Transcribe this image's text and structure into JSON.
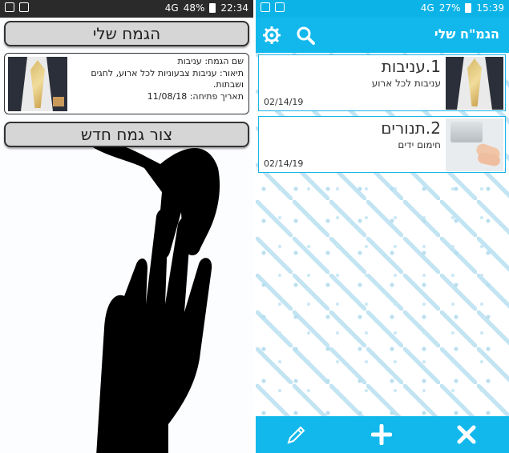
{
  "left_screen": {
    "status_bar": {
      "signal": "4G",
      "battery": "48%",
      "time": "22:34"
    },
    "my_gemach_button": "הגמח שלי",
    "card": {
      "name_line": "שם הגמח: עניבות",
      "desc_line": "תיאור: עניבות צבעוניות לכל ארוע, לחגים ושבתות.",
      "date_line": "תאריך פתיחה: 11/08/18"
    },
    "create_gemach_button": "צור גמח חדש"
  },
  "right_screen": {
    "status_bar": {
      "signal": "4G",
      "battery": "27%",
      "time": "15:39"
    },
    "app_title": "הגמ\"ח שלי",
    "items": [
      {
        "title": "1.עניבות",
        "desc": "עניבות לכל ארוע",
        "date": "02/14/19"
      },
      {
        "title": "2.תנורים",
        "desc": "חימום ידים",
        "date": "02/14/19"
      }
    ],
    "icons": {
      "settings": "gear-icon",
      "search": "search-icon",
      "edit": "pencil-icon",
      "add": "plus-icon",
      "close": "close-icon"
    },
    "colors": {
      "accent": "#12b8ec",
      "pattern": "#b8dff0"
    }
  }
}
